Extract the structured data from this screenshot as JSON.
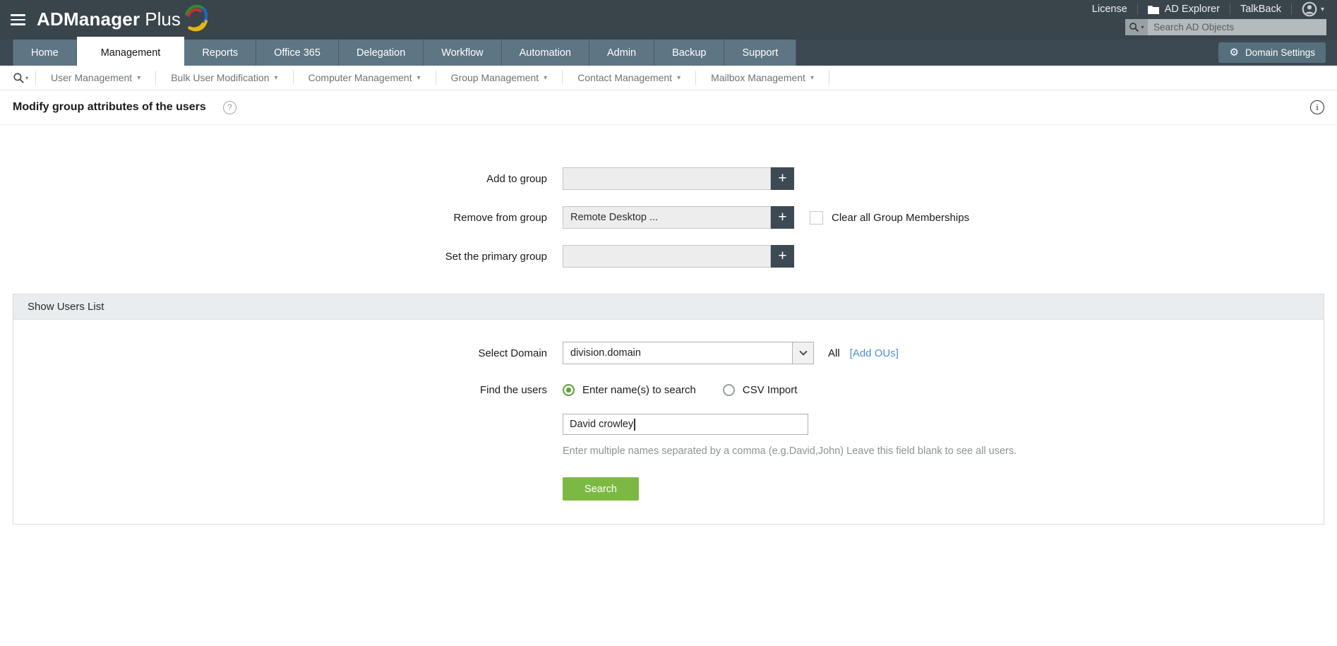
{
  "header": {
    "product_bold": "ADManager",
    "product_light": "Plus",
    "links": [
      "License",
      "AD Explorer",
      "TalkBack"
    ],
    "search_placeholder": "Search AD Objects"
  },
  "nav": {
    "tabs": [
      {
        "label": "Home",
        "active": false
      },
      {
        "label": "Management",
        "active": true
      },
      {
        "label": "Reports",
        "active": false
      },
      {
        "label": "Office 365",
        "active": false
      },
      {
        "label": "Delegation",
        "active": false
      },
      {
        "label": "Workflow",
        "active": false
      },
      {
        "label": "Automation",
        "active": false
      },
      {
        "label": "Admin",
        "active": false
      },
      {
        "label": "Backup",
        "active": false
      },
      {
        "label": "Support",
        "active": false
      }
    ],
    "domain_settings": "Domain Settings"
  },
  "subnav": {
    "items": [
      "User Management",
      "Bulk User Modification",
      "Computer Management",
      "Group Management",
      "Contact Management",
      "Mailbox Management"
    ]
  },
  "page": {
    "title": "Modify group attributes of the users"
  },
  "form": {
    "add_to_group": {
      "label": "Add to group",
      "value": ""
    },
    "remove_from_group": {
      "label": "Remove from group",
      "value": "Remote Desktop ...",
      "clear_checkbox_label": "Clear all Group Memberships",
      "checkbox_checked": false
    },
    "set_primary_group": {
      "label": "Set the primary group",
      "value": ""
    }
  },
  "users_panel": {
    "header": "Show Users List",
    "select_domain": {
      "label": "Select Domain",
      "value": "division.domain",
      "scope": "All",
      "add_ous_link": "[Add OUs]"
    },
    "find_users": {
      "label": "Find the users",
      "options": [
        {
          "label": "Enter name(s) to search",
          "selected": true
        },
        {
          "label": "CSV Import",
          "selected": false
        }
      ]
    },
    "names_input": {
      "value": "David crowley"
    },
    "hint": "Enter multiple names separated by a comma (e.g.David,John) Leave this field blank to see all users.",
    "search_button": "Search"
  },
  "icons": {
    "plus": "+",
    "caret_down": "▾",
    "gear": "⚙",
    "help": "?",
    "info": "i"
  },
  "colors": {
    "topbar_bg": "#39444b",
    "tabrow_bg": "#3d4952",
    "tab_bg": "#5e7583",
    "active_tab_bg": "#ffffff",
    "panel_header_bg": "#e9edef",
    "accent_green": "#7cb944",
    "radio_green": "#61a134",
    "link_blue": "#4a90d2",
    "plus_button_bg": "#3d4a54"
  }
}
